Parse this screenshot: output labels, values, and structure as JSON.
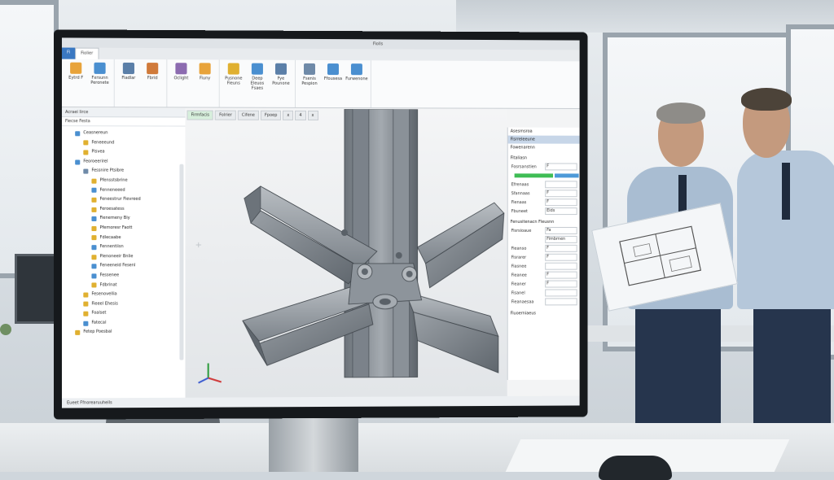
{
  "app": {
    "tabs": [
      "Fi",
      "Fiolier",
      "",
      ""
    ],
    "title_short": "Fiolls"
  },
  "ribbon": [
    {
      "group": "g1",
      "buttons": [
        {
          "label": "Eytrd F",
          "color": "#e8a33a"
        },
        {
          "label": "Fxrsunn Peronete",
          "color": "#4a8fd0"
        }
      ]
    },
    {
      "group": "g2",
      "buttons": [
        {
          "label": "Fiadlar",
          "color": "#5b7fa8"
        },
        {
          "label": "Fbrid",
          "color": "#d07a3a"
        }
      ]
    },
    {
      "group": "g3",
      "buttons": [
        {
          "label": "Oclight",
          "color": "#8c6bb0"
        },
        {
          "label": "Fiuny",
          "color": "#e8a33a"
        }
      ]
    },
    {
      "group": "g4",
      "buttons": [
        {
          "label": "Pusnone Fieuns",
          "color": "#e0b030"
        },
        {
          "label": "Deep Eleuos Fsaes",
          "color": "#4a8fd0"
        },
        {
          "label": "Fye Pounone",
          "color": "#5b7fa8"
        }
      ]
    },
    {
      "group": "g5",
      "buttons": [
        {
          "label": "Fsenis Pespion",
          "color": "#6f8aa8"
        },
        {
          "label": "Ffousesa",
          "color": "#4a8fd0"
        },
        {
          "label": "Furwenone",
          "color": "#4a8fd0"
        }
      ]
    }
  ],
  "tree": {
    "title": "Acraei Iirce",
    "tabs": "Fiecse Festa",
    "items": [
      {
        "label": "Ceasnereun",
        "color": "#4a8fd0",
        "indent": 1
      },
      {
        "label": "Feneeeund",
        "color": "#e0b030",
        "indent": 2
      },
      {
        "label": "Pisvea",
        "color": "#e0b030",
        "indent": 2
      },
      {
        "label": "Feoroeerirel",
        "color": "#4a8fd0",
        "indent": 1
      },
      {
        "label": "Fessnire Ptsibre",
        "color": "#6f8aa8",
        "indent": 2
      },
      {
        "label": "Pfensstsbrine",
        "color": "#e0b030",
        "indent": 3
      },
      {
        "label": "Fenneneeed",
        "color": "#4a8fd0",
        "indent": 3
      },
      {
        "label": "Feneestrur Fievreed",
        "color": "#e0b030",
        "indent": 3
      },
      {
        "label": "Feroesatess",
        "color": "#e0b030",
        "indent": 3
      },
      {
        "label": "Fienemeny Biy",
        "color": "#4a8fd0",
        "indent": 3
      },
      {
        "label": "Pfemoresr Faott",
        "color": "#e0b030",
        "indent": 3
      },
      {
        "label": "Fdlecaabe",
        "color": "#e0b030",
        "indent": 3
      },
      {
        "label": "Fennentiisn",
        "color": "#4a8fd0",
        "indent": 3
      },
      {
        "label": "Pienoneeir Bnlie",
        "color": "#e0b030",
        "indent": 3
      },
      {
        "label": "Feneeneid Fesenl",
        "color": "#4a8fd0",
        "indent": 3
      },
      {
        "label": "Fessenee",
        "color": "#4a8fd0",
        "indent": 3
      },
      {
        "label": "Fdbrinat",
        "color": "#e0b030",
        "indent": 3
      },
      {
        "label": "Fesenovellia",
        "color": "#e0b030",
        "indent": 2
      },
      {
        "label": "Fieeel Ehesis",
        "color": "#e0b030",
        "indent": 2
      },
      {
        "label": "Foalset",
        "color": "#e0b030",
        "indent": 2
      },
      {
        "label": "Fatecal",
        "color": "#4a8fd0",
        "indent": 2
      },
      {
        "label": "Fetep Poesbal",
        "color": "#e0b030",
        "indent": 1
      }
    ]
  },
  "viewport": {
    "tabs": [
      "Firmfacis",
      "Folrier",
      "Cifene",
      "Fpoep"
    ],
    "tab_icons": [
      "x",
      "4",
      "x"
    ]
  },
  "props": {
    "headers": [
      "Asesmsroa",
      "Fisrreleeune",
      "Fowenarenn"
    ],
    "sections": [
      {
        "title": "Fitaliasn",
        "rows": [
          {
            "k": "Fosrsanstien",
            "v": "F"
          },
          {
            "k": "",
            "v": "",
            "bar": true
          },
          {
            "k": "Efrenaas",
            "v": ""
          },
          {
            "k": "Sfannaas",
            "v": "F"
          },
          {
            "k": "Fienaas",
            "v": "F"
          },
          {
            "k": "Fbuneet",
            "v": "Eids"
          }
        ]
      },
      {
        "title": "Fenusitenacn Fleusnn",
        "rows": [
          {
            "k": "Fisrsioaue",
            "v": "Fa"
          },
          {
            "k": "",
            "v": "Fimbrnen"
          },
          {
            "k": "Fieanso",
            "v": "F"
          },
          {
            "k": "Fisrarer",
            "v": "F"
          },
          {
            "k": "Fiasnee",
            "v": ""
          },
          {
            "k": "Fieanee",
            "v": "F"
          },
          {
            "k": "Fieaner",
            "v": "F"
          },
          {
            "k": "Fisanel",
            "v": ""
          },
          {
            "k": "Fieanaesaa",
            "v": ""
          }
        ]
      }
    ],
    "footer": "Fiuoerniaeus"
  },
  "status": "Eueet Ffnorearuuheils"
}
